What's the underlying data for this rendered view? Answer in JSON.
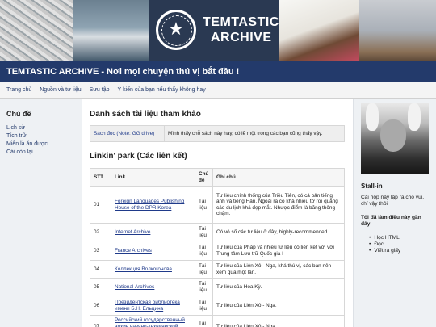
{
  "banner": {
    "logo_line1": "TEMTASTIC",
    "logo_line2": "ARCHIVE",
    "seal_glyph": "★"
  },
  "site_title": "TEMTASTIC ARCHIVE - Nơi mọi chuyện thú vị bắt đầu !",
  "nav": [
    "Trang chủ",
    "Nguồn và tư liệu",
    "Sưu tập",
    "Ý kiến của bạn nếu thấy không hay"
  ],
  "sidebar": {
    "heading": "Chủ đề",
    "items": [
      "Lịch sử",
      "Tích trữ",
      "Miễn là ăn được",
      "Cái còn lại"
    ]
  },
  "main": {
    "heading1": "Danh sách tài liệu tham khảo",
    "ref": {
      "link": "Sách đọc (Note: GG drive)",
      "desc": "Mình thấy chỗ sách này hay, có lẽ một trong các bạn cũng thấy vậy."
    },
    "heading2": "Linkin' park (Các liên kết)",
    "table": {
      "headers": [
        "STT",
        "Link",
        "Chủ đề",
        "Ghi chú"
      ],
      "rows": [
        {
          "stt": "01",
          "link": "Foreign Languages Publishing House of the DPR Korea",
          "topic": "Tài liệu",
          "note": "Tư liệu chính thống của Triều Tiên, có cả bản tiếng anh và tiếng Hàn. Ngoài ra có khá nhiều tờ rơi quảng cáo du lịch khá đẹp mắt. Nhược điểm là băng thông chậm."
        },
        {
          "stt": "02",
          "link": "Internet Archive",
          "topic": "Tài liệu",
          "note": "Có vô số các tư liệu ở đây, highly-recommended"
        },
        {
          "stt": "03",
          "link": "France Archives",
          "topic": "Tài liệu",
          "note": "Tư liệu của Pháp và nhiều tư liệu có liên kết với với Trung tâm Lưu trữ Quốc gia I"
        },
        {
          "stt": "04",
          "link": "Коллекция Волкогонова",
          "topic": "Tài liệu",
          "note": "Tư liệu của Liên Xô - Nga, khá thú vị, các bạn nên xem qua một lần."
        },
        {
          "stt": "05",
          "link": "National Archives",
          "topic": "Tài liệu",
          "note": "Tư liệu của Hoa Kỳ."
        },
        {
          "stt": "06",
          "link": "Президентская библиотека имени Б.Н. Ельцина",
          "topic": "Tài liệu",
          "note": "Tư liệu của Liên Xô - Nga."
        },
        {
          "stt": "07",
          "link": "Российский государственный архив научно-технической документации",
          "topic": "Tài liệu",
          "note": "Tư liệu của Liên Xô - Nga."
        }
      ]
    }
  },
  "right": {
    "name": "Stall-in",
    "bio": "Cái hộp này lập ra cho vui, chỉ vậy thôi",
    "did_heading": "Tôi đã làm điều này gần đây",
    "did_items": [
      "Học HTML",
      "Đọc",
      "Viết ra giấy"
    ]
  }
}
